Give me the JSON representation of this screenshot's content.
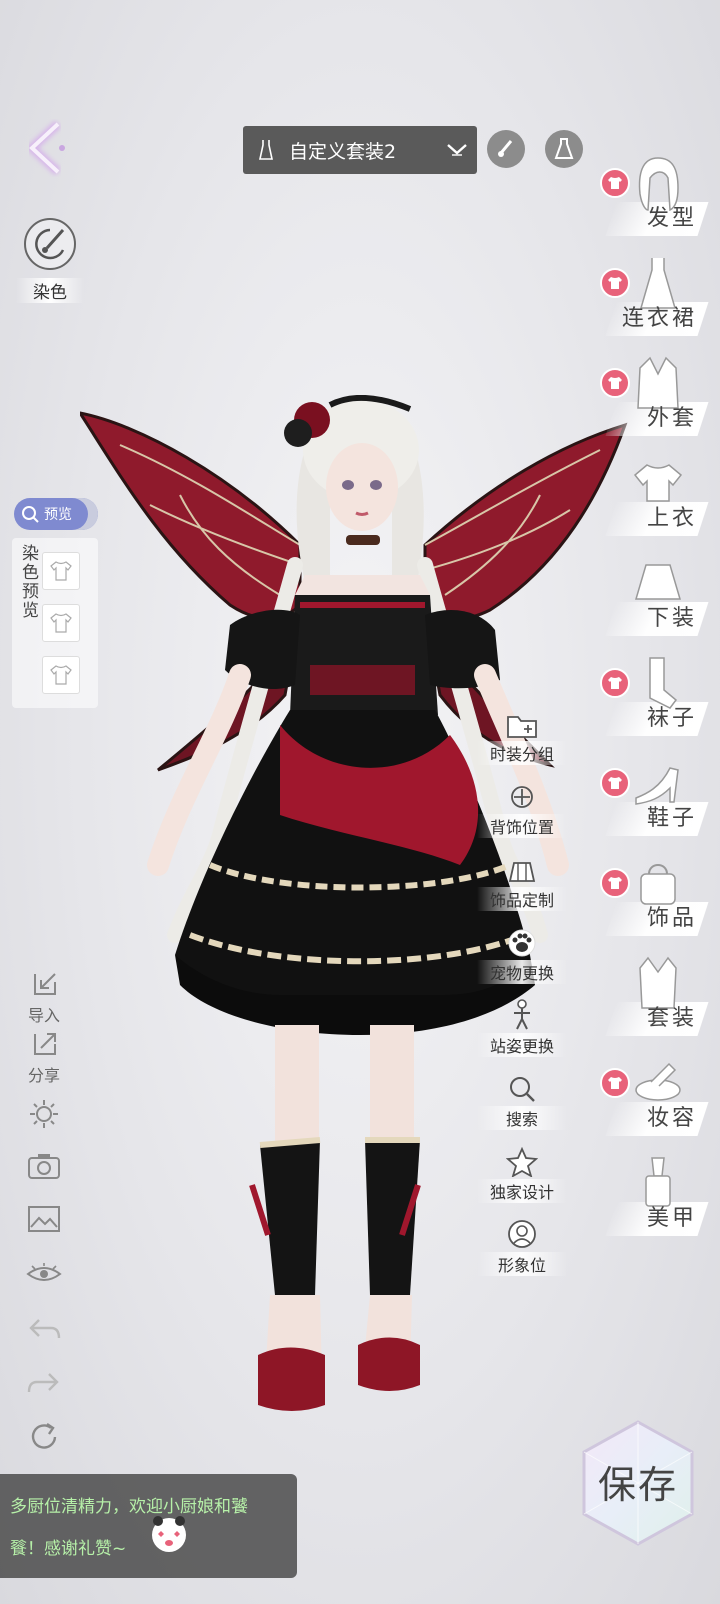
{
  "header": {
    "outfit_name": "自定义套装2"
  },
  "left_panel": {
    "dye_label": "染色",
    "preview_label": "预览",
    "dye_preview_label": "染色预览"
  },
  "actions": [
    {
      "label": "时装分组",
      "icon": "folder-icon"
    },
    {
      "label": "背饰位置",
      "icon": "move-icon"
    },
    {
      "label": "饰品定制",
      "icon": "accessory-custom-icon"
    },
    {
      "label": "宠物更换",
      "icon": "paw-icon"
    },
    {
      "label": "站姿更换",
      "icon": "pose-icon"
    },
    {
      "label": "搜索",
      "icon": "search-icon"
    },
    {
      "label": "独家设计",
      "icon": "star-icon"
    },
    {
      "label": "形象位",
      "icon": "portrait-icon"
    }
  ],
  "categories": [
    {
      "label": "发型",
      "badge": true,
      "icon": "hair-icon"
    },
    {
      "label": "连衣裙",
      "badge": true,
      "icon": "dress-icon"
    },
    {
      "label": "外套",
      "badge": true,
      "icon": "coat-icon"
    },
    {
      "label": "上衣",
      "badge": false,
      "icon": "top-icon"
    },
    {
      "label": "下装",
      "badge": false,
      "icon": "skirt-icon"
    },
    {
      "label": "袜子",
      "badge": true,
      "icon": "socks-icon"
    },
    {
      "label": "鞋子",
      "badge": true,
      "icon": "heels-icon"
    },
    {
      "label": "饰品",
      "badge": true,
      "icon": "bag-icon"
    },
    {
      "label": "套装",
      "badge": false,
      "icon": "suit-icon"
    },
    {
      "label": "妆容",
      "badge": true,
      "icon": "makeup-icon"
    },
    {
      "label": "美甲",
      "badge": false,
      "icon": "nail-polish-icon"
    }
  ],
  "toolbar": {
    "import_label": "导入",
    "share_label": "分享"
  },
  "save_label": "保存",
  "chat": {
    "line1": "多厨位清精力，欢迎小厨娘和饕",
    "line2": "餮！感谢礼赞~"
  },
  "colors": {
    "accent_badge": "#e8627a",
    "chat_text": "#b6f0a8",
    "dress_red": "#a0172d"
  }
}
